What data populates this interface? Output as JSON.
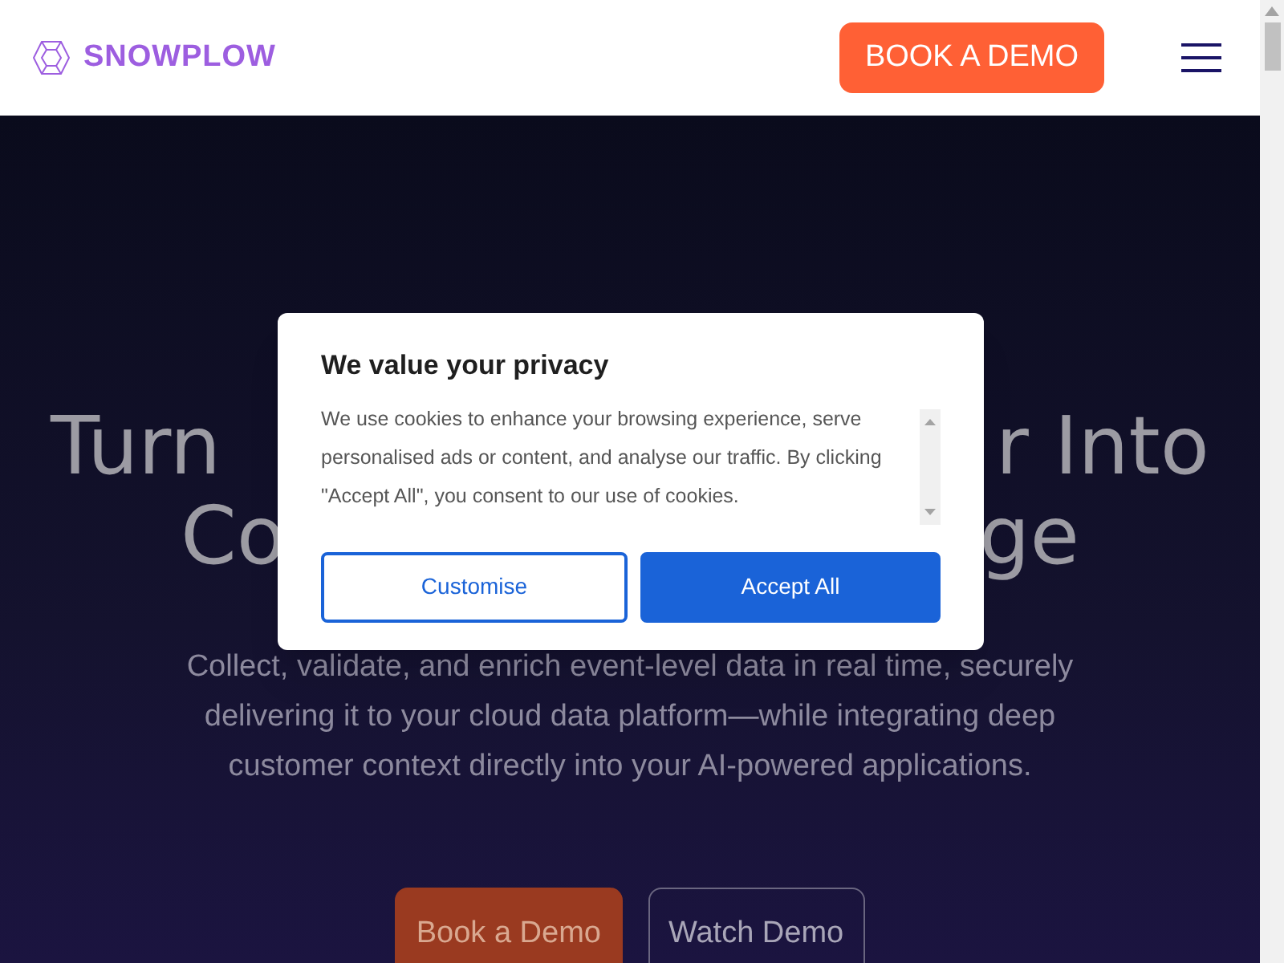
{
  "header": {
    "logo": "SNOWPLOW",
    "cta": "BOOK A DEMO"
  },
  "hero": {
    "heading_lines": [
      {
        "left": "Turn",
        "right": "r Into"
      },
      {
        "left": "Co",
        "right": "ge"
      }
    ],
    "subtitle": "Collect, validate, and enrich event-level data in real time, securely delivering it to your cloud data platform—while integrating deep customer context directly into your AI-powered applications.",
    "buttons": [
      {
        "label": "Book a Demo",
        "kind": "primary"
      },
      {
        "label": "Watch Demo",
        "kind": "outline"
      }
    ]
  },
  "cookie_dialog": {
    "title": "We value your privacy",
    "body": "We use cookies to enhance your browsing experience, serve personalised ads or content, and analyse our traffic. By clicking \"Accept All\", you consent to our use of cookies.",
    "buttons": [
      {
        "label": "Customise",
        "kind": "outline"
      },
      {
        "label": "Accept All",
        "kind": "primary"
      }
    ]
  }
}
